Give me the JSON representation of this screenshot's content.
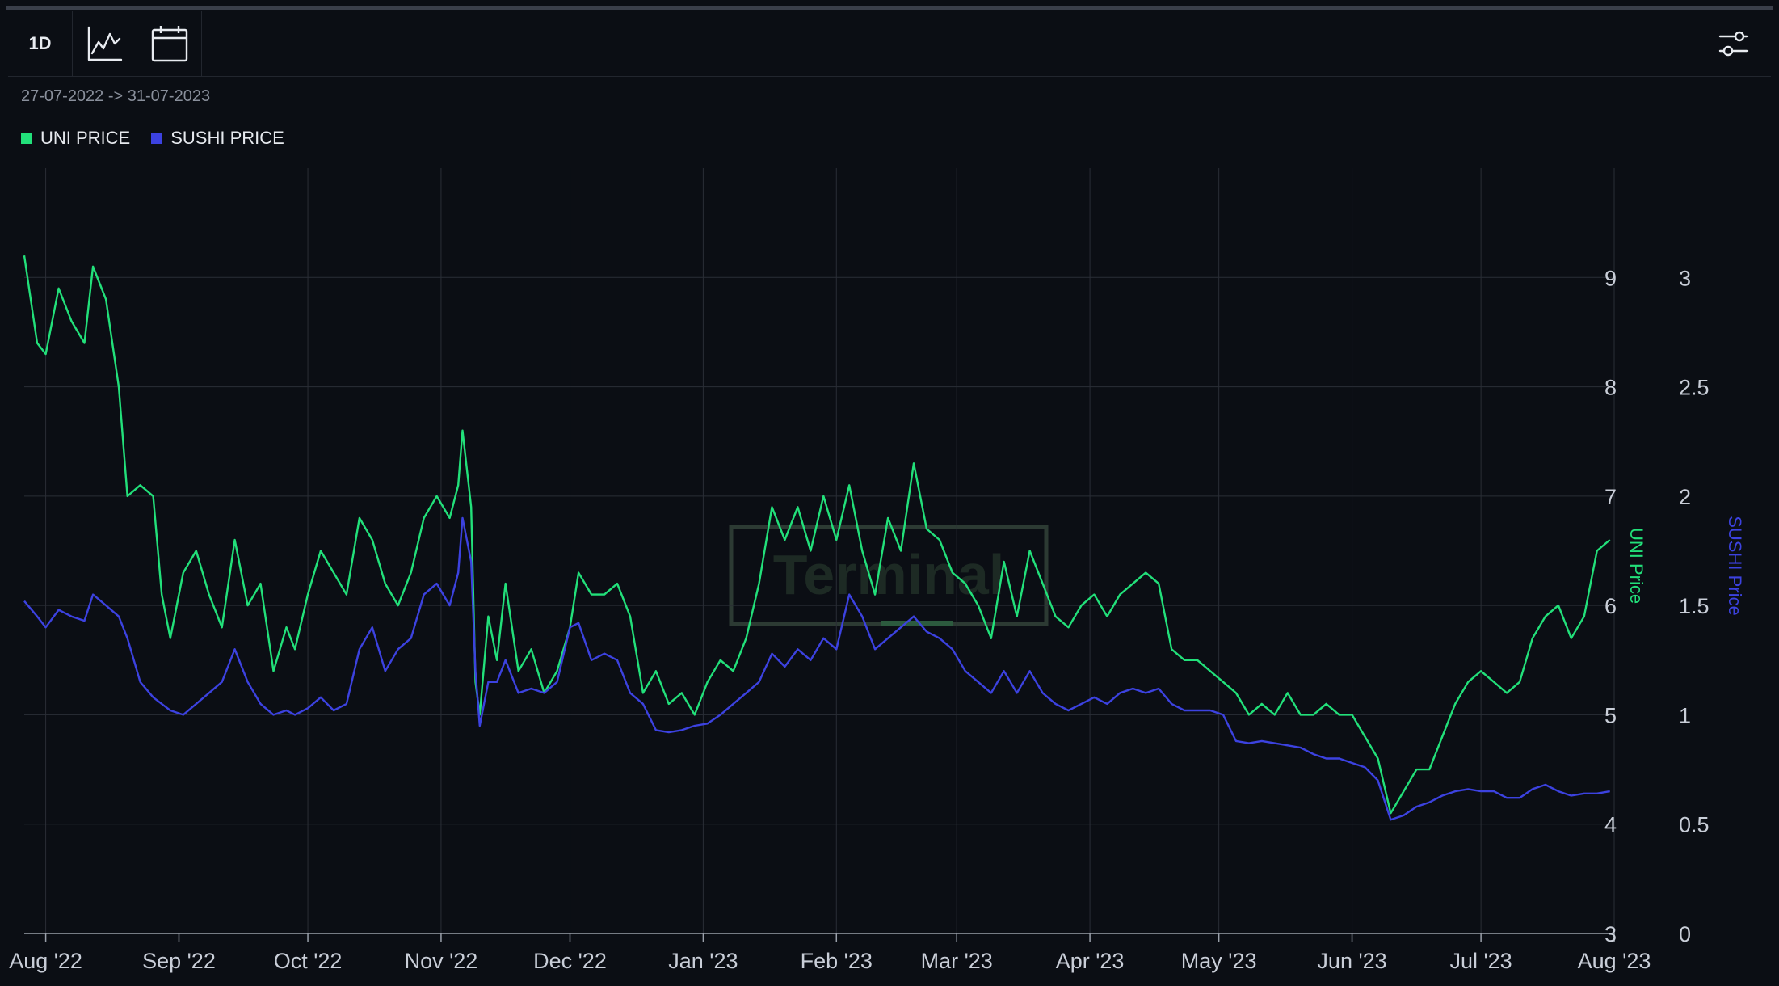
{
  "toolbar": {
    "interval_label": "1D"
  },
  "date_range": "27-07-2022 -> 31-07-2023",
  "legend": [
    {
      "label": "UNI PRICE",
      "color": "#22e07a"
    },
    {
      "label": "SUSHI PRICE",
      "color": "#3c42e0"
    }
  ],
  "watermark": "Terminal",
  "colors": {
    "background": "#0b0e14",
    "grid": "#2a2e36",
    "uni": "#22e07a",
    "sushi": "#3c42e0",
    "axis_text": "#c9ced8"
  },
  "chart_data": {
    "type": "line",
    "x_start": "2022-07-27",
    "x_end": "2023-07-31",
    "x_ticks": [
      {
        "label": "Aug '22",
        "date": "2022-08-01"
      },
      {
        "label": "Sep '22",
        "date": "2022-09-01"
      },
      {
        "label": "Oct '22",
        "date": "2022-10-01"
      },
      {
        "label": "Nov '22",
        "date": "2022-11-01"
      },
      {
        "label": "Dec '22",
        "date": "2022-12-01"
      },
      {
        "label": "Jan '23",
        "date": "2023-01-01"
      },
      {
        "label": "Feb '23",
        "date": "2023-02-01"
      },
      {
        "label": "Mar '23",
        "date": "2023-03-01"
      },
      {
        "label": "Apr '23",
        "date": "2023-04-01"
      },
      {
        "label": "May '23",
        "date": "2023-05-01"
      },
      {
        "label": "Jun '23",
        "date": "2023-06-01"
      },
      {
        "label": "Jul '23",
        "date": "2023-07-01"
      },
      {
        "label": "Aug '23",
        "date": "2023-08-01"
      }
    ],
    "y_left": {
      "label": "UNI Price",
      "range": [
        3,
        10
      ],
      "ticks": [
        3,
        4,
        5,
        6,
        7,
        8,
        9
      ]
    },
    "y_right": {
      "label": "SUSHI Price",
      "range": [
        0,
        3.5
      ],
      "ticks": [
        0,
        0.5,
        1,
        1.5,
        2,
        2.5,
        3
      ]
    },
    "grid": true,
    "legend_position": "top-left",
    "series": [
      {
        "name": "UNI PRICE",
        "axis": "left",
        "points": [
          [
            "2022-07-27",
            9.2
          ],
          [
            "2022-07-30",
            8.4
          ],
          [
            "2022-08-01",
            8.3
          ],
          [
            "2022-08-04",
            8.9
          ],
          [
            "2022-08-07",
            8.6
          ],
          [
            "2022-08-10",
            8.4
          ],
          [
            "2022-08-12",
            9.1
          ],
          [
            "2022-08-15",
            8.8
          ],
          [
            "2022-08-18",
            8.0
          ],
          [
            "2022-08-20",
            7.0
          ],
          [
            "2022-08-23",
            7.1
          ],
          [
            "2022-08-26",
            7.0
          ],
          [
            "2022-08-28",
            6.1
          ],
          [
            "2022-08-30",
            5.7
          ],
          [
            "2022-09-02",
            6.3
          ],
          [
            "2022-09-05",
            6.5
          ],
          [
            "2022-09-08",
            6.1
          ],
          [
            "2022-09-11",
            5.8
          ],
          [
            "2022-09-14",
            6.6
          ],
          [
            "2022-09-17",
            6.0
          ],
          [
            "2022-09-20",
            6.2
          ],
          [
            "2022-09-23",
            5.4
          ],
          [
            "2022-09-26",
            5.8
          ],
          [
            "2022-09-28",
            5.6
          ],
          [
            "2022-10-01",
            6.1
          ],
          [
            "2022-10-04",
            6.5
          ],
          [
            "2022-10-07",
            6.3
          ],
          [
            "2022-10-10",
            6.1
          ],
          [
            "2022-10-13",
            6.8
          ],
          [
            "2022-10-16",
            6.6
          ],
          [
            "2022-10-19",
            6.2
          ],
          [
            "2022-10-22",
            6.0
          ],
          [
            "2022-10-25",
            6.3
          ],
          [
            "2022-10-28",
            6.8
          ],
          [
            "2022-10-31",
            7.0
          ],
          [
            "2022-11-03",
            6.8
          ],
          [
            "2022-11-05",
            7.1
          ],
          [
            "2022-11-06",
            7.6
          ],
          [
            "2022-11-08",
            6.9
          ],
          [
            "2022-11-09",
            5.3
          ],
          [
            "2022-11-10",
            5.0
          ],
          [
            "2022-11-12",
            5.9
          ],
          [
            "2022-11-14",
            5.5
          ],
          [
            "2022-11-16",
            6.2
          ],
          [
            "2022-11-19",
            5.4
          ],
          [
            "2022-11-22",
            5.6
          ],
          [
            "2022-11-25",
            5.2
          ],
          [
            "2022-11-28",
            5.4
          ],
          [
            "2022-12-01",
            5.8
          ],
          [
            "2022-12-03",
            6.3
          ],
          [
            "2022-12-06",
            6.1
          ],
          [
            "2022-12-09",
            6.1
          ],
          [
            "2022-12-12",
            6.2
          ],
          [
            "2022-12-15",
            5.9
          ],
          [
            "2022-12-18",
            5.2
          ],
          [
            "2022-12-21",
            5.4
          ],
          [
            "2022-12-24",
            5.1
          ],
          [
            "2022-12-27",
            5.2
          ],
          [
            "2022-12-30",
            5.0
          ],
          [
            "2023-01-02",
            5.3
          ],
          [
            "2023-01-05",
            5.5
          ],
          [
            "2023-01-08",
            5.4
          ],
          [
            "2023-01-11",
            5.7
          ],
          [
            "2023-01-14",
            6.2
          ],
          [
            "2023-01-17",
            6.9
          ],
          [
            "2023-01-20",
            6.6
          ],
          [
            "2023-01-23",
            6.9
          ],
          [
            "2023-01-26",
            6.5
          ],
          [
            "2023-01-29",
            7.0
          ],
          [
            "2023-02-01",
            6.6
          ],
          [
            "2023-02-04",
            7.1
          ],
          [
            "2023-02-07",
            6.5
          ],
          [
            "2023-02-10",
            6.1
          ],
          [
            "2023-02-13",
            6.8
          ],
          [
            "2023-02-16",
            6.5
          ],
          [
            "2023-02-19",
            7.3
          ],
          [
            "2023-02-22",
            6.7
          ],
          [
            "2023-02-25",
            6.6
          ],
          [
            "2023-02-28",
            6.3
          ],
          [
            "2023-03-03",
            6.2
          ],
          [
            "2023-03-06",
            6.0
          ],
          [
            "2023-03-09",
            5.7
          ],
          [
            "2023-03-12",
            6.4
          ],
          [
            "2023-03-15",
            5.9
          ],
          [
            "2023-03-18",
            6.5
          ],
          [
            "2023-03-21",
            6.2
          ],
          [
            "2023-03-24",
            5.9
          ],
          [
            "2023-03-27",
            5.8
          ],
          [
            "2023-03-30",
            6.0
          ],
          [
            "2023-04-02",
            6.1
          ],
          [
            "2023-04-05",
            5.9
          ],
          [
            "2023-04-08",
            6.1
          ],
          [
            "2023-04-11",
            6.2
          ],
          [
            "2023-04-14",
            6.3
          ],
          [
            "2023-04-17",
            6.2
          ],
          [
            "2023-04-20",
            5.6
          ],
          [
            "2023-04-23",
            5.5
          ],
          [
            "2023-04-26",
            5.5
          ],
          [
            "2023-04-29",
            5.4
          ],
          [
            "2023-05-02",
            5.3
          ],
          [
            "2023-05-05",
            5.2
          ],
          [
            "2023-05-08",
            5.0
          ],
          [
            "2023-05-11",
            5.1
          ],
          [
            "2023-05-14",
            5.0
          ],
          [
            "2023-05-17",
            5.2
          ],
          [
            "2023-05-20",
            5.0
          ],
          [
            "2023-05-23",
            5.0
          ],
          [
            "2023-05-26",
            5.1
          ],
          [
            "2023-05-29",
            5.0
          ],
          [
            "2023-06-01",
            5.0
          ],
          [
            "2023-06-04",
            4.8
          ],
          [
            "2023-06-07",
            4.6
          ],
          [
            "2023-06-10",
            4.1
          ],
          [
            "2023-06-13",
            4.3
          ],
          [
            "2023-06-16",
            4.5
          ],
          [
            "2023-06-19",
            4.5
          ],
          [
            "2023-06-22",
            4.8
          ],
          [
            "2023-06-25",
            5.1
          ],
          [
            "2023-06-28",
            5.3
          ],
          [
            "2023-07-01",
            5.4
          ],
          [
            "2023-07-04",
            5.3
          ],
          [
            "2023-07-07",
            5.2
          ],
          [
            "2023-07-10",
            5.3
          ],
          [
            "2023-07-13",
            5.7
          ],
          [
            "2023-07-16",
            5.9
          ],
          [
            "2023-07-19",
            6.0
          ],
          [
            "2023-07-22",
            5.7
          ],
          [
            "2023-07-25",
            5.9
          ],
          [
            "2023-07-28",
            6.5
          ],
          [
            "2023-07-31",
            6.6
          ]
        ]
      },
      {
        "name": "SUSHI PRICE",
        "axis": "right",
        "points": [
          [
            "2022-07-27",
            1.52
          ],
          [
            "2022-07-30",
            1.45
          ],
          [
            "2022-08-01",
            1.4
          ],
          [
            "2022-08-04",
            1.48
          ],
          [
            "2022-08-07",
            1.45
          ],
          [
            "2022-08-10",
            1.43
          ],
          [
            "2022-08-12",
            1.55
          ],
          [
            "2022-08-15",
            1.5
          ],
          [
            "2022-08-18",
            1.45
          ],
          [
            "2022-08-20",
            1.35
          ],
          [
            "2022-08-23",
            1.15
          ],
          [
            "2022-08-26",
            1.08
          ],
          [
            "2022-08-28",
            1.05
          ],
          [
            "2022-08-30",
            1.02
          ],
          [
            "2022-09-02",
            1.0
          ],
          [
            "2022-09-05",
            1.05
          ],
          [
            "2022-09-08",
            1.1
          ],
          [
            "2022-09-11",
            1.15
          ],
          [
            "2022-09-14",
            1.3
          ],
          [
            "2022-09-17",
            1.15
          ],
          [
            "2022-09-20",
            1.05
          ],
          [
            "2022-09-23",
            1.0
          ],
          [
            "2022-09-26",
            1.02
          ],
          [
            "2022-09-28",
            1.0
          ],
          [
            "2022-10-01",
            1.03
          ],
          [
            "2022-10-04",
            1.08
          ],
          [
            "2022-10-07",
            1.02
          ],
          [
            "2022-10-10",
            1.05
          ],
          [
            "2022-10-13",
            1.3
          ],
          [
            "2022-10-16",
            1.4
          ],
          [
            "2022-10-19",
            1.2
          ],
          [
            "2022-10-22",
            1.3
          ],
          [
            "2022-10-25",
            1.35
          ],
          [
            "2022-10-28",
            1.55
          ],
          [
            "2022-10-31",
            1.6
          ],
          [
            "2022-11-03",
            1.5
          ],
          [
            "2022-11-05",
            1.65
          ],
          [
            "2022-11-06",
            1.9
          ],
          [
            "2022-11-08",
            1.7
          ],
          [
            "2022-11-09",
            1.2
          ],
          [
            "2022-11-10",
            0.95
          ],
          [
            "2022-11-12",
            1.15
          ],
          [
            "2022-11-14",
            1.15
          ],
          [
            "2022-11-16",
            1.25
          ],
          [
            "2022-11-19",
            1.1
          ],
          [
            "2022-11-22",
            1.12
          ],
          [
            "2022-11-25",
            1.1
          ],
          [
            "2022-11-28",
            1.15
          ],
          [
            "2022-12-01",
            1.4
          ],
          [
            "2022-12-03",
            1.42
          ],
          [
            "2022-12-06",
            1.25
          ],
          [
            "2022-12-09",
            1.28
          ],
          [
            "2022-12-12",
            1.25
          ],
          [
            "2022-12-15",
            1.1
          ],
          [
            "2022-12-18",
            1.05
          ],
          [
            "2022-12-21",
            0.93
          ],
          [
            "2022-12-24",
            0.92
          ],
          [
            "2022-12-27",
            0.93
          ],
          [
            "2022-12-30",
            0.95
          ],
          [
            "2023-01-02",
            0.96
          ],
          [
            "2023-01-05",
            1.0
          ],
          [
            "2023-01-08",
            1.05
          ],
          [
            "2023-01-11",
            1.1
          ],
          [
            "2023-01-14",
            1.15
          ],
          [
            "2023-01-17",
            1.28
          ],
          [
            "2023-01-20",
            1.22
          ],
          [
            "2023-01-23",
            1.3
          ],
          [
            "2023-01-26",
            1.25
          ],
          [
            "2023-01-29",
            1.35
          ],
          [
            "2023-02-01",
            1.3
          ],
          [
            "2023-02-04",
            1.55
          ],
          [
            "2023-02-07",
            1.45
          ],
          [
            "2023-02-10",
            1.3
          ],
          [
            "2023-02-13",
            1.35
          ],
          [
            "2023-02-16",
            1.4
          ],
          [
            "2023-02-19",
            1.45
          ],
          [
            "2023-02-22",
            1.38
          ],
          [
            "2023-02-25",
            1.35
          ],
          [
            "2023-02-28",
            1.3
          ],
          [
            "2023-03-03",
            1.2
          ],
          [
            "2023-03-06",
            1.15
          ],
          [
            "2023-03-09",
            1.1
          ],
          [
            "2023-03-12",
            1.2
          ],
          [
            "2023-03-15",
            1.1
          ],
          [
            "2023-03-18",
            1.2
          ],
          [
            "2023-03-21",
            1.1
          ],
          [
            "2023-03-24",
            1.05
          ],
          [
            "2023-03-27",
            1.02
          ],
          [
            "2023-03-30",
            1.05
          ],
          [
            "2023-04-02",
            1.08
          ],
          [
            "2023-04-05",
            1.05
          ],
          [
            "2023-04-08",
            1.1
          ],
          [
            "2023-04-11",
            1.12
          ],
          [
            "2023-04-14",
            1.1
          ],
          [
            "2023-04-17",
            1.12
          ],
          [
            "2023-04-20",
            1.05
          ],
          [
            "2023-04-23",
            1.02
          ],
          [
            "2023-04-26",
            1.02
          ],
          [
            "2023-04-29",
            1.02
          ],
          [
            "2023-05-02",
            1.0
          ],
          [
            "2023-05-05",
            0.88
          ],
          [
            "2023-05-08",
            0.87
          ],
          [
            "2023-05-11",
            0.88
          ],
          [
            "2023-05-14",
            0.87
          ],
          [
            "2023-05-17",
            0.86
          ],
          [
            "2023-05-20",
            0.85
          ],
          [
            "2023-05-23",
            0.82
          ],
          [
            "2023-05-26",
            0.8
          ],
          [
            "2023-05-29",
            0.8
          ],
          [
            "2023-06-01",
            0.78
          ],
          [
            "2023-06-04",
            0.76
          ],
          [
            "2023-06-07",
            0.7
          ],
          [
            "2023-06-10",
            0.52
          ],
          [
            "2023-06-13",
            0.54
          ],
          [
            "2023-06-16",
            0.58
          ],
          [
            "2023-06-19",
            0.6
          ],
          [
            "2023-06-22",
            0.63
          ],
          [
            "2023-06-25",
            0.65
          ],
          [
            "2023-06-28",
            0.66
          ],
          [
            "2023-07-01",
            0.65
          ],
          [
            "2023-07-04",
            0.65
          ],
          [
            "2023-07-07",
            0.62
          ],
          [
            "2023-07-10",
            0.62
          ],
          [
            "2023-07-13",
            0.66
          ],
          [
            "2023-07-16",
            0.68
          ],
          [
            "2023-07-19",
            0.65
          ],
          [
            "2023-07-22",
            0.63
          ],
          [
            "2023-07-25",
            0.64
          ],
          [
            "2023-07-28",
            0.64
          ],
          [
            "2023-07-31",
            0.65
          ]
        ]
      }
    ]
  }
}
